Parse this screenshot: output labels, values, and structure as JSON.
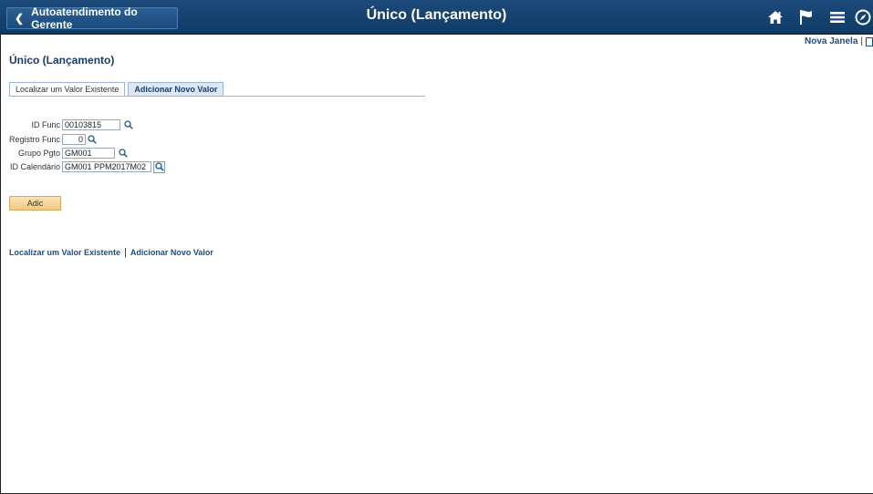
{
  "banner": {
    "back_label": "Autoatendimento do Gerente",
    "title": "Único (Lançamento)",
    "icons": [
      "home-icon",
      "flag-icon",
      "menu-icon",
      "navbar-icon"
    ]
  },
  "new_window": {
    "label": "Nova Janela",
    "separator": "|"
  },
  "page": {
    "title": "Único (Lançamento)"
  },
  "tabs": [
    {
      "label": "Localizar um Valor Existente",
      "active": false
    },
    {
      "label": "Adicionar Novo Valor",
      "active": true
    }
  ],
  "form": {
    "id_func": {
      "label": "ID Func",
      "value": "00103815"
    },
    "registro_func": {
      "label": "Registro Func",
      "value": "0"
    },
    "grupo_pgto": {
      "label": "Grupo Pgto",
      "value": "GM001"
    },
    "id_calendario": {
      "label": "ID Calendário",
      "value": "GM001 PPM2017M02"
    }
  },
  "buttons": {
    "add_label": "Adic"
  },
  "bottom_links": {
    "find_existing": "Localizar um Valor Existente",
    "separator": "|",
    "add_new": "Adicionar Novo Valor"
  },
  "colors": {
    "banner": "#0f3b67",
    "link": "#1a4f8b",
    "add_button": "#f2c983"
  }
}
